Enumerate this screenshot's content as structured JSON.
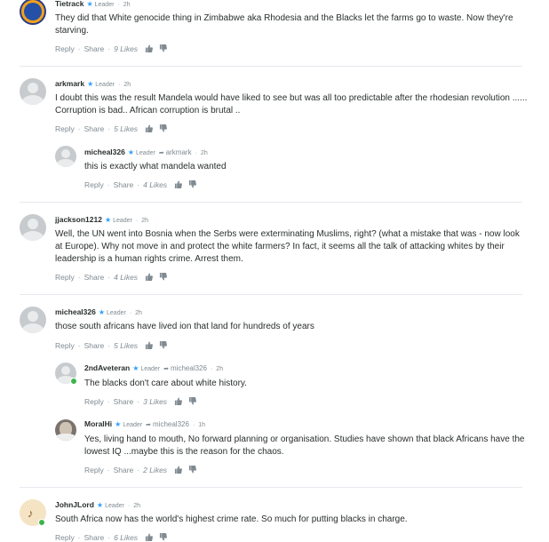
{
  "comments": [
    {
      "author": "Tietrack",
      "badge": "Leader",
      "time": "2h",
      "reply_to": "",
      "avatar_text": "",
      "text": "They did that White genocide thing in Zimbabwe aka Rhodesia and the Blacks let the farms go to waste. Now they're starving.",
      "reply_label": "Reply",
      "share_label": "Share",
      "likes": "9 Likes"
    },
    {
      "author": "arkmark",
      "badge": "Leader",
      "time": "2h",
      "reply_to": "",
      "text": "I doubt this was the result Mandela would have liked to see but was all too predictable after the rhodesian revolution ...... Corruption is bad.. African corruption is brutal ..",
      "reply_label": "Reply",
      "share_label": "Share",
      "likes": "5 Likes"
    },
    {
      "author": "micheal326",
      "badge": "Leader",
      "time": "2h",
      "reply_to": "arkmark",
      "text": "this is exactly what mandela wanted",
      "reply_label": "Reply",
      "share_label": "Share",
      "likes": "4 Likes"
    },
    {
      "author": "jjackson1212",
      "badge": "Leader",
      "time": "2h",
      "reply_to": "",
      "text": "Well, the UN went into Bosnia when the Serbs were exterminating Muslims, right? (what a mistake that was - now look at Europe). Why not move in and protect the white farmers? In fact, it seems all the talk of attacking whites by their leadership is a human rights crime. Arrest them.",
      "reply_label": "Reply",
      "share_label": "Share",
      "likes": "4 Likes"
    },
    {
      "author": "micheal326",
      "badge": "Leader",
      "time": "2h",
      "reply_to": "",
      "text": "those south africans have lived ion that land for hundreds of years",
      "reply_label": "Reply",
      "share_label": "Share",
      "likes": "5 Likes"
    },
    {
      "author": "2ndAveteran",
      "badge": "Leader",
      "time": "2h",
      "reply_to": "micheal326",
      "text": "The blacks don't care about white history.",
      "reply_label": "Reply",
      "share_label": "Share",
      "likes": "3 Likes"
    },
    {
      "author": "MoralHi",
      "badge": "Leader",
      "time": "1h",
      "reply_to": "micheal326",
      "text": "Yes, living hand to mouth, No forward planning or organisation. Studies have shown that black Africans have the lowest IQ ...maybe this is the reason for the chaos.",
      "reply_label": "Reply",
      "share_label": "Share",
      "likes": "2 Likes"
    },
    {
      "author": "JohnJLord",
      "badge": "Leader",
      "time": "2h",
      "reply_to": "",
      "text": "South Africa now has the world's highest crime rate. So much for putting blacks in charge.",
      "reply_label": "Reply",
      "share_label": "Share",
      "likes": "6 Likes"
    }
  ],
  "icons": {
    "leader_star": "star-icon",
    "reply_arrow": "reply-arrow-icon",
    "upvote": "thumbs-up-icon",
    "downvote": "thumbs-down-icon"
  },
  "colors": {
    "leader_star": "#2e9fff",
    "online": "#3cb44b",
    "muted": "#7f8a91",
    "text": "#2a2e2e"
  }
}
